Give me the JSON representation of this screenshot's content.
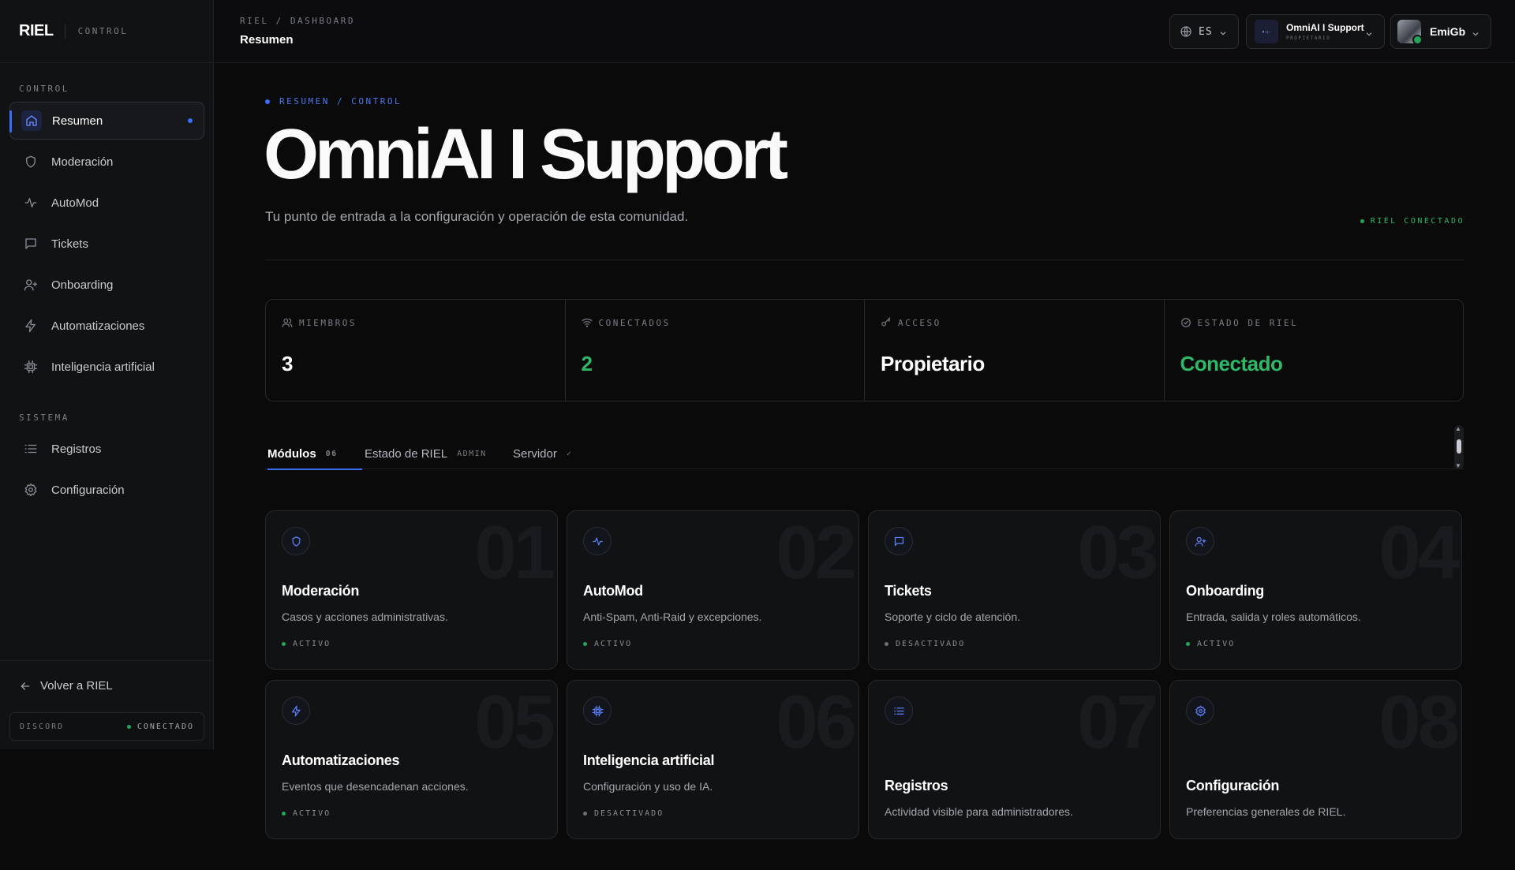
{
  "sidebar": {
    "brand": "RIEL",
    "brand_sub": "CONTROL",
    "section_control": "CONTROL",
    "section_system": "SISTEMA",
    "items": [
      {
        "label": "Resumen"
      },
      {
        "label": "Moderación"
      },
      {
        "label": "AutoMod"
      },
      {
        "label": "Tickets"
      },
      {
        "label": "Onboarding"
      },
      {
        "label": "Automatizaciones"
      },
      {
        "label": "Inteligencia artificial"
      }
    ],
    "system_items": [
      {
        "label": "Registros"
      },
      {
        "label": "Configuración"
      }
    ],
    "back_label": "Volver a RIEL",
    "discord_label": "DISCORD",
    "discord_status": "CONECTADO"
  },
  "topbar": {
    "breadcrumb": "RIEL / DASHBOARD",
    "title": "Resumen",
    "language": "ES",
    "server_avatar_text": "•·‹·",
    "server_name": "OmniAI I Support",
    "server_role": "PROPIETARIO",
    "user_name": "EmiGb"
  },
  "hero": {
    "kicker": "RESUMEN / CONTROL",
    "title": "OmniAI I Support",
    "subtitle": "Tu punto de entrada a la configuración y operación de esta comunidad.",
    "status": "RIEL CONECTADO"
  },
  "stats": [
    {
      "label": "MIEMBROS",
      "value": "3"
    },
    {
      "label": "CONECTADOS",
      "value": "2"
    },
    {
      "label": "ACCESO",
      "value": "Propietario"
    },
    {
      "label": "ESTADO DE RIEL",
      "value": "Conectado"
    }
  ],
  "tabs": [
    {
      "label": "Módulos",
      "badge": "06"
    },
    {
      "label": "Estado de RIEL",
      "badge": "ADMIN"
    },
    {
      "label": "Servidor",
      "badge": "✓"
    }
  ],
  "modules": [
    {
      "num": "01",
      "title": "Moderación",
      "desc": "Casos y acciones administrativas.",
      "status": "ACTIVO",
      "icon": "shield-icon"
    },
    {
      "num": "02",
      "title": "AutoMod",
      "desc": "Anti-Spam, Anti-Raid y excepciones.",
      "status": "ACTIVO",
      "icon": "activity-icon"
    },
    {
      "num": "03",
      "title": "Tickets",
      "desc": "Soporte y ciclo de atención.",
      "status": "DESACTIVADO",
      "icon": "chat-icon"
    },
    {
      "num": "04",
      "title": "Onboarding",
      "desc": "Entrada, salida y roles automáticos.",
      "status": "ACTIVO",
      "icon": "user-plus-icon"
    },
    {
      "num": "05",
      "title": "Automatizaciones",
      "desc": "Eventos que desencadenan acciones.",
      "status": "ACTIVO",
      "icon": "bolt-icon"
    },
    {
      "num": "06",
      "title": "Inteligencia artificial",
      "desc": "Configuración y uso de IA.",
      "status": "DESACTIVADO",
      "icon": "chip-icon"
    },
    {
      "num": "07",
      "title": "Registros",
      "desc": "Actividad visible para administradores.",
      "icon": "list-icon"
    },
    {
      "num": "08",
      "title": "Configuración",
      "desc": "Preferencias generales de RIEL.",
      "icon": "gear-icon"
    }
  ],
  "colors": {
    "accent": "#3b6ef5",
    "success": "#2fb866",
    "background": "#0a0a0b"
  }
}
